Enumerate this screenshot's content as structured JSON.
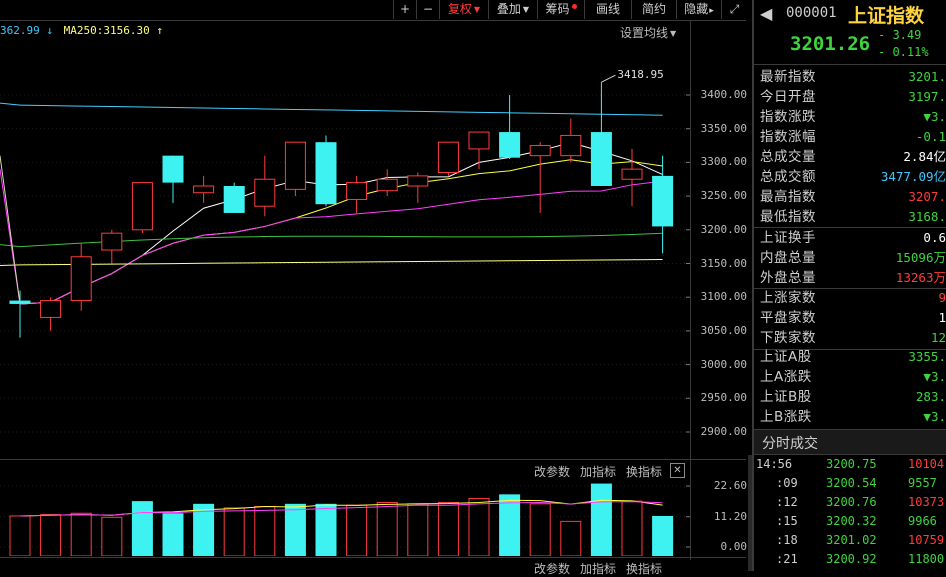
{
  "toolbar": {
    "plus": "+",
    "minus": "−",
    "fuquan": "复权",
    "diejia": "叠加",
    "chouma": "筹码",
    "huaxian": "画线",
    "jianyue": "简约",
    "yincang": "隐藏",
    "prefix_arrows": "▸",
    "fullscreen": "⤢"
  },
  "ma_line": {
    "ma_prev_value": "362.99",
    "ma_prev_arrow": "↓",
    "ma250_text": "MA250:3156.30",
    "ma250_arrow": "↑",
    "setting": "设置均线"
  },
  "price_axis": [
    "3400.00",
    "3350.00",
    "3300.00",
    "3250.00",
    "3200.00",
    "3150.00",
    "3100.00",
    "3050.00",
    "3000.00",
    "2950.00",
    "2900.00"
  ],
  "high_label": "3418.95",
  "volume_panel": {
    "btn_params": "改参数",
    "btn_add": "加指标",
    "btn_switch": "换指标",
    "close": "✕",
    "axis": [
      "22.60",
      "11.20",
      "0.00"
    ]
  },
  "bottom_panel": {
    "btn_params": "改参数",
    "btn_add": "加指标",
    "btn_switch": "换指标"
  },
  "colors": {
    "up": "#ff3c3c",
    "down": "#3ff2f2",
    "ma5": "#ffffff",
    "ma10": "#ffff40",
    "ma20": "#ff40ff",
    "ma60": "#40c040",
    "ma120": "#40d0ff",
    "ma250": "#ffff80"
  },
  "chart_data": {
    "type": "candlestick",
    "ylim": [
      2860,
      3460
    ],
    "candles": [
      {
        "o": 3095,
        "h": 3110,
        "l": 3040,
        "c": 3090,
        "dir": "down"
      },
      {
        "o": 3070,
        "h": 3100,
        "l": 3050,
        "c": 3095,
        "dir": "up"
      },
      {
        "o": 3095,
        "h": 3180,
        "l": 3080,
        "c": 3160,
        "dir": "up"
      },
      {
        "o": 3170,
        "h": 3200,
        "l": 3150,
        "c": 3195,
        "dir": "up"
      },
      {
        "o": 3200,
        "h": 3270,
        "l": 3195,
        "c": 3270,
        "dir": "up"
      },
      {
        "o": 3310,
        "h": 3310,
        "l": 3240,
        "c": 3270,
        "dir": "down"
      },
      {
        "o": 3255,
        "h": 3280,
        "l": 3240,
        "c": 3265,
        "dir": "up"
      },
      {
        "o": 3265,
        "h": 3270,
        "l": 3225,
        "c": 3225,
        "dir": "down"
      },
      {
        "o": 3235,
        "h": 3310,
        "l": 3220,
        "c": 3275,
        "dir": "up"
      },
      {
        "o": 3260,
        "h": 3330,
        "l": 3250,
        "c": 3330,
        "dir": "up"
      },
      {
        "o": 3330,
        "h": 3340,
        "l": 3235,
        "c": 3238,
        "dir": "down"
      },
      {
        "o": 3245,
        "h": 3280,
        "l": 3225,
        "c": 3270,
        "dir": "up"
      },
      {
        "o": 3258,
        "h": 3290,
        "l": 3250,
        "c": 3275,
        "dir": "up"
      },
      {
        "o": 3265,
        "h": 3285,
        "l": 3240,
        "c": 3280,
        "dir": "up"
      },
      {
        "o": 3285,
        "h": 3330,
        "l": 3280,
        "c": 3330,
        "dir": "up"
      },
      {
        "o": 3320,
        "h": 3345,
        "l": 3290,
        "c": 3345,
        "dir": "up"
      },
      {
        "o": 3345,
        "h": 3400,
        "l": 3305,
        "c": 3307,
        "dir": "down"
      },
      {
        "o": 3310,
        "h": 3330,
        "l": 3225,
        "c": 3325,
        "dir": "up"
      },
      {
        "o": 3310,
        "h": 3365,
        "l": 3300,
        "c": 3340,
        "dir": "up"
      },
      {
        "o": 3345,
        "h": 3418.95,
        "l": 3265,
        "c": 3265,
        "dir": "down"
      },
      {
        "o": 3290,
        "h": 3320,
        "l": 3235,
        "c": 3275,
        "dir": "up"
      },
      {
        "o": 3280,
        "h": 3310,
        "l": 3165,
        "c": 3205,
        "dir": "down"
      }
    ],
    "volumes": [
      {
        "v": 11.5,
        "dir": "up"
      },
      {
        "v": 12.0,
        "dir": "up"
      },
      {
        "v": 12.5,
        "dir": "up"
      },
      {
        "v": 11.0,
        "dir": "up"
      },
      {
        "v": 17.0,
        "dir": "down"
      },
      {
        "v": 12.5,
        "dir": "down"
      },
      {
        "v": 16.0,
        "dir": "down"
      },
      {
        "v": 14.5,
        "dir": "up"
      },
      {
        "v": 15.0,
        "dir": "up"
      },
      {
        "v": 16.0,
        "dir": "down"
      },
      {
        "v": 16.0,
        "dir": "down"
      },
      {
        "v": 15.5,
        "dir": "up"
      },
      {
        "v": 16.5,
        "dir": "up"
      },
      {
        "v": 16.0,
        "dir": "up"
      },
      {
        "v": 16.5,
        "dir": "up"
      },
      {
        "v": 18.0,
        "dir": "up"
      },
      {
        "v": 19.5,
        "dir": "down"
      },
      {
        "v": 16.0,
        "dir": "up"
      },
      {
        "v": 9.5,
        "dir": "up"
      },
      {
        "v": 23.5,
        "dir": "down"
      },
      {
        "v": 17.0,
        "dir": "up"
      },
      {
        "v": 11.5,
        "dir": "down"
      }
    ],
    "vol_ylim": [
      0,
      26
    ]
  },
  "right_panel": {
    "code": "000001",
    "name": "上证指数",
    "price": "3201.26",
    "change": "- 3.49",
    "change_pct": "- 0.11%",
    "rows": [
      {
        "label": "最新指数",
        "value": "3201.",
        "color": "#3fd43f"
      },
      {
        "label": "今日开盘",
        "value": "3197.",
        "color": "#3fd43f"
      },
      {
        "label": "指数涨跌",
        "value": "▼3.",
        "color": "#3fd43f"
      },
      {
        "label": "指数涨幅",
        "value": "-0.1",
        "color": "#3fd43f"
      },
      {
        "label": "总成交量",
        "value": "2.84亿",
        "color": "#ffffff"
      },
      {
        "label": "总成交额",
        "value": "3477.09亿",
        "color": "#3fc8ff"
      },
      {
        "label": "最高指数",
        "value": "3207.",
        "color": "#ff3c3c"
      },
      {
        "label": "最低指数",
        "value": "3168.",
        "color": "#3fd43f"
      }
    ],
    "rows2": [
      {
        "label": "上证换手",
        "value": "0.6",
        "color": "#ffffff"
      },
      {
        "label": "内盘总量",
        "value": "15096万",
        "color": "#3fd43f"
      },
      {
        "label": "外盘总量",
        "value": "13263万",
        "color": "#ff3c3c"
      }
    ],
    "rows3": [
      {
        "label": "上涨家数",
        "value": "9",
        "color": "#ff3c3c"
      },
      {
        "label": "平盘家数",
        "value": "1",
        "color": "#ffffff"
      },
      {
        "label": "下跌家数",
        "value": "12",
        "color": "#3fd43f"
      }
    ],
    "rows4": [
      {
        "label": "上证A股",
        "value": "3355.",
        "color": "#3fd43f"
      },
      {
        "label": "上A涨跌",
        "value": "▼3.",
        "color": "#3fd43f"
      },
      {
        "label": "上证B股",
        "value": "283.",
        "color": "#3fd43f"
      },
      {
        "label": "上B涨跌",
        "value": "▼3.",
        "color": "#3fd43f"
      }
    ],
    "ticks_title": "分时成交",
    "ticks": [
      {
        "time": "14:56",
        "price": "3200.75",
        "vol": "10104"
      },
      {
        "time": ":09",
        "price": "3200.54",
        "vol": "9557"
      },
      {
        "time": ":12",
        "price": "3200.76",
        "vol": "10373"
      },
      {
        "time": ":15",
        "price": "3200.32",
        "vol": "9966"
      },
      {
        "time": ":18",
        "price": "3201.02",
        "vol": "10759"
      },
      {
        "time": ":21",
        "price": "3200.92",
        "vol": "11800"
      }
    ]
  }
}
